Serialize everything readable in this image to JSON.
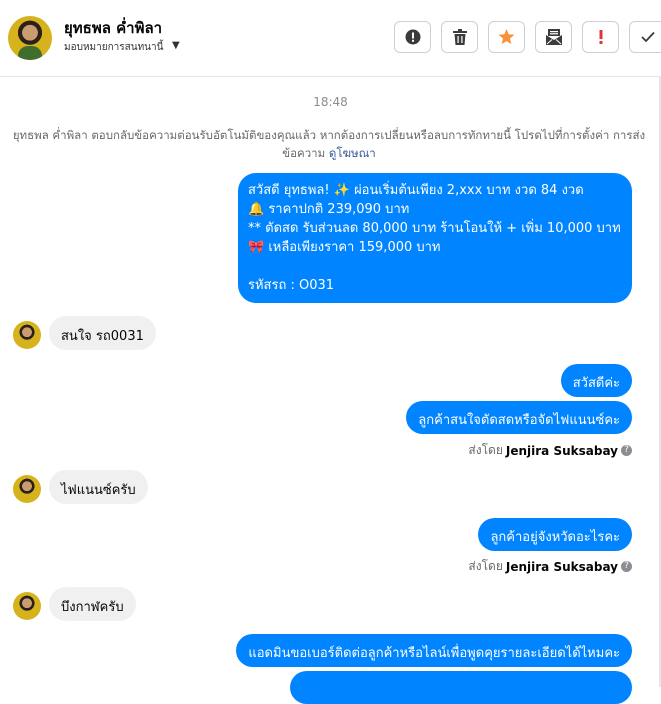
{
  "header": {
    "name": "ยุทธพล ค่ำพิลา",
    "assign_label": "มอบหมายการสนทนานี้",
    "actions": [
      {
        "name": "info-button",
        "icon": "alert-circle-icon"
      },
      {
        "name": "delete-button",
        "icon": "trash-icon"
      },
      {
        "name": "star-button",
        "icon": "star-icon"
      },
      {
        "name": "mark-unread-button",
        "icon": "envelope-icon"
      },
      {
        "name": "spam-button",
        "icon": "exclamation-icon"
      },
      {
        "name": "done-button",
        "icon": "check-icon"
      }
    ],
    "star_color": "#f7923b",
    "spam_color": "#e4333a"
  },
  "conversation": {
    "timestamp": "18:48",
    "notice": "ยุทธพล ค่ำพิลา ตอบกลับข้อความต่อนรับอัตโนมัติของคุณแล้ว หากต้องการเปลี่ยนหรือลบการทักทายนี้ โปรดไปที่การตั้งค่า การส่งข้อความ",
    "notice_link": "ดูโฆษณา",
    "messages": [
      {
        "lines": [
          "สวัสดี ยุทธพล! ✨  ผ่อนเริ่มต้นเพียง 2,xxx บาท งวด 84 งวด",
          "🔔 ราคาปกติ 239,090 บาท",
          "** ตัดสด รับส่วนลด 80,000 บาท ร้านโอนให้ + เพิ่ม 10,000 บาท",
          "🎀  เหลือเพียงราคา 159,000 บาท",
          "",
          "รหัสรถ : O031"
        ]
      },
      {
        "text": "สนใจ รถ0031"
      },
      {
        "text": "สวัสดีค่ะ"
      },
      {
        "text": "ลูกค้าสนใจตัดสดหรือจัดไฟแนนซ์คะ"
      },
      {
        "sent_by_label": "ส่งโดย",
        "sender": "Jenjira Suksabay"
      },
      {
        "text": "ไฟแนนซ์ครับ"
      },
      {
        "text": "ลูกค้าอยู่จังหวัดอะไรคะ"
      },
      {
        "sent_by_label": "ส่งโดย",
        "sender": "Jenjira Suksabay"
      },
      {
        "text": "บึงกาฬครับ"
      },
      {
        "text": "แอดมินขอเบอร์ติดต่อลูกค้าหรือไลน์เพื่อพูดคุยรายละเอียดได้ไหมคะ"
      }
    ]
  },
  "colors": {
    "outgoing_bubble": "#0084ff",
    "incoming_bubble": "#f0f0f0",
    "link": "#385898"
  }
}
